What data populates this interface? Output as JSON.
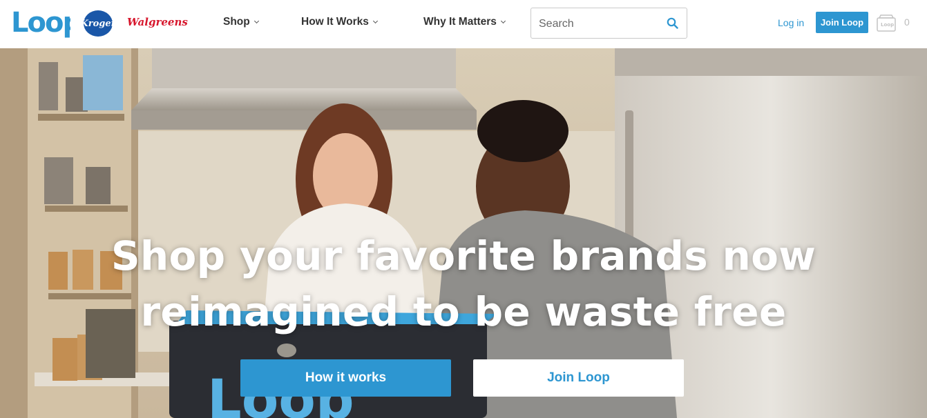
{
  "header": {
    "logo_text": "Loop",
    "partners": {
      "kroger": "Kroger",
      "walgreens": "Walgreens"
    },
    "nav": [
      {
        "label": "Shop"
      },
      {
        "label": "How It Works"
      },
      {
        "label": "Why It Matters"
      }
    ],
    "search": {
      "placeholder": "Search",
      "value": ""
    },
    "login_label": "Log in",
    "join_label": "Join Loop",
    "tote_label": "Loop",
    "cart_count": "0"
  },
  "hero": {
    "headline_line1": "Shop your favorite brands now",
    "headline_line2": "reimagined to be waste free",
    "primary_button": "How it works",
    "secondary_button": "Join Loop",
    "bag_logo": "Loop"
  },
  "colors": {
    "accent": "#2d96d1",
    "walgreens_red": "#d7162c",
    "kroger_blue": "#1a57a8"
  }
}
